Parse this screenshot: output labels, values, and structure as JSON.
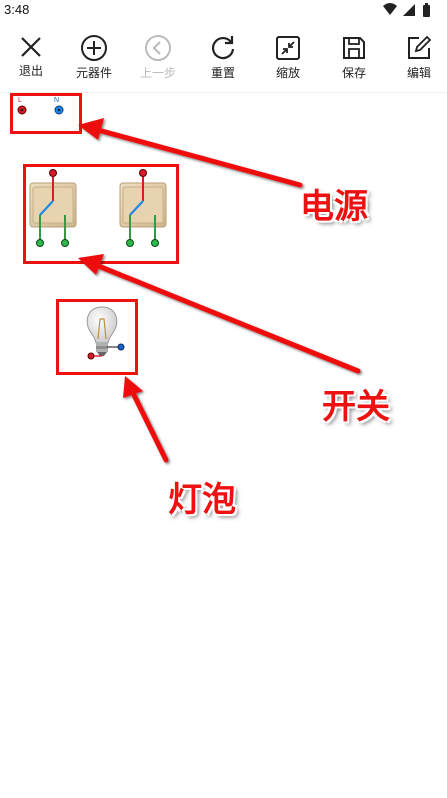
{
  "status_bar": {
    "time": "3:48",
    "icons": [
      "wifi-icon",
      "signal-icon",
      "battery-icon"
    ]
  },
  "toolbar": {
    "exit": {
      "label": "退出",
      "icon": "close-icon"
    },
    "components": {
      "label": "元器件",
      "icon": "plus-circle-icon"
    },
    "undo": {
      "label": "上一步",
      "icon": "back-circle-icon",
      "disabled": true
    },
    "reset": {
      "label": "重置",
      "icon": "refresh-icon"
    },
    "zoom": {
      "label": "缩放",
      "icon": "shrink-icon"
    },
    "save": {
      "label": "保存",
      "icon": "save-icon"
    },
    "edit": {
      "label": "编辑",
      "icon": "edit-icon"
    }
  },
  "canvas": {
    "power_source": {
      "terminal_l": "L",
      "terminal_n": "N",
      "l_color": "#d81b2a",
      "n_color": "#1565c0"
    },
    "switches": [
      {
        "name": "switch-1"
      },
      {
        "name": "switch-2"
      }
    ],
    "bulb": {
      "name": "light-bulb"
    }
  },
  "annotations": {
    "power": "电源",
    "switch": "开关",
    "bulb": "灯泡",
    "color": "#ee1111"
  }
}
